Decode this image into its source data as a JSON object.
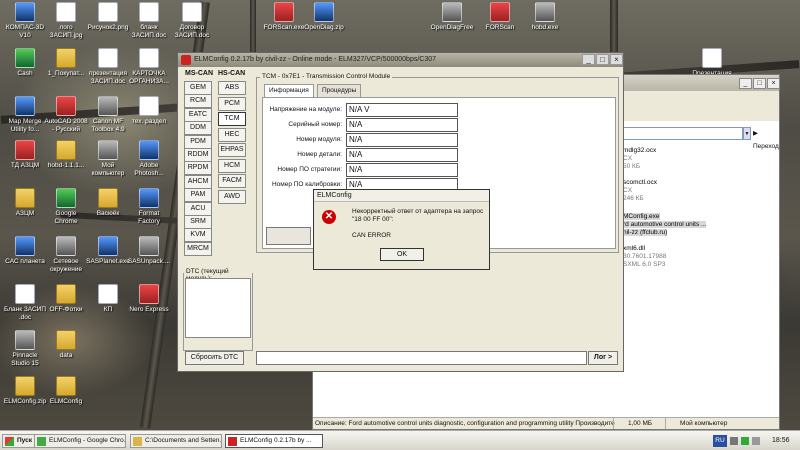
{
  "desktop": {
    "icons": [
      {
        "label": "КОМПАС-3D V10",
        "x": 0,
        "y": 0,
        "kind": "blue"
      },
      {
        "label": "лого ЗАСИП.jpg",
        "kind": "doc"
      },
      {
        "label": "Рисунок2.png",
        "kind": "doc"
      },
      {
        "label": "бланк ЗАСИП.doc",
        "kind": "doc"
      },
      {
        "label": "Договор ЗАСИП.doc",
        "kind": "doc"
      },
      {
        "label": "FORScan.exe",
        "kind": "app"
      },
      {
        "label": "OpenDiag.zip",
        "kind": "blue"
      },
      {
        "label": "OpenDiagFree",
        "kind": "gray"
      },
      {
        "label": "FORScan",
        "kind": "app"
      },
      {
        "label": "hobd.exe",
        "kind": "gray"
      },
      {
        "label": "Cash",
        "kind": "grn"
      },
      {
        "label": "1_Покупат...",
        "kind": "fold"
      },
      {
        "label": "презентация ЗАСИП.doc",
        "kind": "doc"
      },
      {
        "label": "КАРТОЧКА ОРГАНИЗА...",
        "kind": "doc"
      },
      {
        "label": "Презентация",
        "kind": "doc"
      },
      {
        "label": "Map Merge Utility fo...",
        "kind": "blue"
      },
      {
        "label": "AutoCAD 2008 - Русский",
        "kind": "app"
      },
      {
        "label": "Canon MF Toolbox 4.9",
        "kind": "gray"
      },
      {
        "label": "тех. раздел",
        "kind": "doc"
      },
      {
        "label": "ТД АЗЦМ",
        "kind": "app"
      },
      {
        "label": "hobd-1.1.1...",
        "kind": "fold"
      },
      {
        "label": "Мой компьютер",
        "kind": "gray"
      },
      {
        "label": "Adobe Photosh...",
        "kind": "blue"
      },
      {
        "label": "АЗЦМ",
        "kind": "fold"
      },
      {
        "label": "Google Chrome",
        "kind": "grn"
      },
      {
        "label": "Васюёк",
        "kind": "fold"
      },
      {
        "label": "Format Factory",
        "kind": "blue"
      },
      {
        "label": "САС планета",
        "kind": "blue"
      },
      {
        "label": "Сетевое окружение",
        "kind": "gray"
      },
      {
        "label": "SASPlanet.exe",
        "kind": "blue"
      },
      {
        "label": "SASUnpack....",
        "kind": "gray"
      },
      {
        "label": "Бланк ЗАСИП .doc",
        "kind": "doc"
      },
      {
        "label": "OFF-Фотки",
        "kind": "fold"
      },
      {
        "label": "КП",
        "kind": "doc"
      },
      {
        "label": "Nero Express",
        "kind": "app"
      },
      {
        "label": "Pinnacle Studio 15",
        "kind": "gray"
      },
      {
        "label": "data",
        "kind": "fold"
      },
      {
        "label": "ELMConfig.zip",
        "kind": "fold"
      },
      {
        "label": "ELMConfig",
        "kind": "fold"
      }
    ]
  },
  "explorer": {
    "go_label": "Переход",
    "rows": [
      {
        "text": "mdlg32.ocx",
        "cls": ""
      },
      {
        "text": "CX",
        "cls": "s"
      },
      {
        "text": "50 КБ",
        "cls": "s"
      },
      {
        "text": "scomctl.ocx",
        "cls": ""
      },
      {
        "text": "CX",
        "cls": "s"
      },
      {
        "text": "246 КБ",
        "cls": "s"
      },
      {
        "text": "MConfig.exe",
        "cls": "hl"
      },
      {
        "text": "rd automotive control units ...",
        "cls": "hl"
      },
      {
        "text": "nil-zz (ffclub.ru)",
        "cls": "hl"
      },
      {
        "text": "xml6.dll",
        "cls": ""
      },
      {
        "text": "30.7601.17988",
        "cls": "s"
      },
      {
        "text": "SXML 6.0 SP3",
        "cls": "s"
      }
    ],
    "status_desc": "Описание: Ford automotive control units diagnostic, configuration and programming utility Производите",
    "status_size": "1,00 МБ",
    "status_loc": "Мой компьютер"
  },
  "window": {
    "title": "ELMConfig 0.2.17b by civil-zz - Online mode - ELM327/VCP/500000bps/C307",
    "ms_can_label": "MS-CAN",
    "hs_can_label": "HS-CAN",
    "ms_can": [
      "GEM",
      "RCM",
      "EATC",
      "DDM",
      "PDM",
      "RDDM",
      "RPDM",
      "AHCM",
      "PAM",
      "ACU",
      "SRM",
      "KVM",
      "MRCM"
    ],
    "hs_can": [
      "ABS",
      "PCM",
      "TCM",
      "HEC",
      "EHPAS",
      "HCM",
      "FACM",
      "AWD"
    ],
    "module_group": "TCM - 0x7E1 - Transmission Control Module",
    "tabs": [
      "Информация",
      "Процедуры"
    ],
    "fields": [
      {
        "label": "Напряжение на модуле:",
        "value": "N/A V"
      },
      {
        "label": "Серийный номер:",
        "value": "N/A"
      },
      {
        "label": "Номер модуля:",
        "value": "N/A"
      },
      {
        "label": "Номер детали:",
        "value": "N/A"
      },
      {
        "label": "Номер ПО стратегии:",
        "value": "N/A"
      },
      {
        "label": "Номер ПО калибровки:",
        "value": "N/A"
      },
      {
        "label": "Ве",
        "value": ""
      }
    ],
    "dtc_group": "DTC (текущий модуль):",
    "reset_dtc": "Сбросить DTC",
    "log_button": "Лог >"
  },
  "dialog": {
    "title": "ELMConfig",
    "line1": "Некорректный ответ от адаптера на запрос",
    "line2": "\"18 00 FF 00\":",
    "line3": "CAN ERROR",
    "ok": "OK"
  },
  "taskbar": {
    "start": "Пуск",
    "items": [
      {
        "label": "ELMConfig - Google Chro...",
        "active": false
      },
      {
        "label": "C:\\Documents and Setten...",
        "active": false
      },
      {
        "label": "ELMConfig 0.2.17b by ...",
        "active": true
      }
    ],
    "lang": "RU",
    "clock": "18:56"
  }
}
